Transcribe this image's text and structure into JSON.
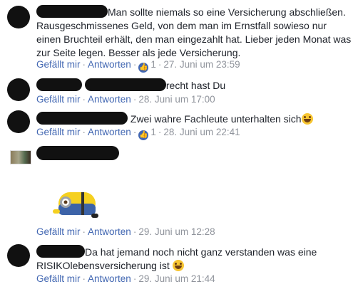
{
  "comments": [
    {
      "text_line1": "Man sollte niemals so eine Versicherung abschließen.",
      "text_rest": "Rausgeschmissenes Geld, von dem man im Ernstfall sowieso nur einen Bruchteil erhält, den man eingezahlt hat. Lieber jeden Monat was zur Seite legen. Besser als jede Versicherung.",
      "like_label": "Gefällt mir",
      "reply_label": "Antworten",
      "like_count": "1",
      "timestamp": "27. Juni um 23:59"
    },
    {
      "text": "recht hast Du",
      "like_label": "Gefällt mir",
      "reply_label": "Antworten",
      "timestamp": "28. Juni um 17:00"
    },
    {
      "text": "Zwei wahre Fachleute unterhalten sich",
      "like_label": "Gefällt mir",
      "reply_label": "Antworten",
      "like_count": "1",
      "timestamp": "28. Juni um 22:41"
    },
    {
      "like_label": "Gefällt mir",
      "reply_label": "Antworten",
      "timestamp": "29. Juni um 12:28"
    },
    {
      "text_line1": "Da hat jemand noch nicht ganz verstanden was eine",
      "text_line2": "RISIKOlebensversicherung ist",
      "like_label": "Gefällt mir",
      "reply_label": "Antworten",
      "timestamp": "29. Juni um 21:44"
    }
  ],
  "icons": {
    "like": "thumbs-up-icon",
    "emoji": "grinning-face-icon"
  },
  "colors": {
    "link": "#4267b2",
    "meta": "#90949c",
    "text": "#1d2129"
  }
}
